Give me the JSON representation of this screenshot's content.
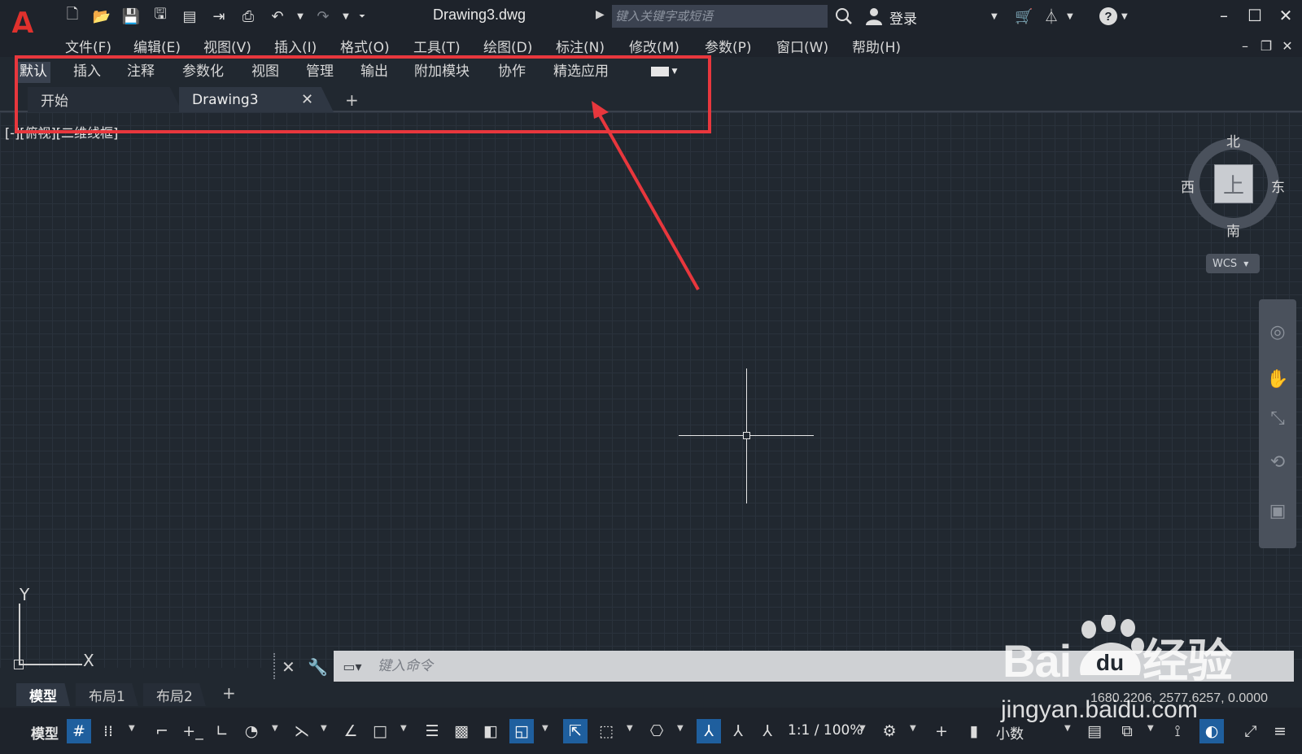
{
  "app": {
    "title": "Drawing3.dwg",
    "logo_letter": "A"
  },
  "title_bar": {
    "search_placeholder": "键入关键字或短语",
    "login_label": "登录",
    "icons": [
      "new-icon",
      "open-icon",
      "save-icon",
      "save-as-icon",
      "plot-preview-icon",
      "export-icon",
      "print-icon",
      "undo-icon",
      "redo-icon",
      "customize-icon",
      "search-icon",
      "user-icon",
      "cart-icon",
      "autodesk-icon",
      "help-icon"
    ]
  },
  "menu": {
    "items": [
      "文件(F)",
      "编辑(E)",
      "视图(V)",
      "插入(I)",
      "格式(O)",
      "工具(T)",
      "绘图(D)",
      "标注(N)",
      "修改(M)",
      "参数(P)",
      "窗口(W)",
      "帮助(H)"
    ]
  },
  "ribbon": {
    "tabs": [
      "默认",
      "插入",
      "注释",
      "参数化",
      "视图",
      "管理",
      "输出",
      "附加模块",
      "协作",
      "精选应用"
    ],
    "active_tab": "默认"
  },
  "file_tabs": {
    "tabs": [
      "开始",
      "Drawing3"
    ],
    "active": "Drawing3",
    "add_label": "+"
  },
  "viewport": {
    "label": "[-][俯视][二维线框]"
  },
  "viewcube": {
    "north": "北",
    "south": "南",
    "east": "东",
    "west": "西",
    "face": "上",
    "wcs_label": "WCS"
  },
  "ucs": {
    "x_label": "X",
    "y_label": "Y"
  },
  "command_line": {
    "placeholder": "键入命令"
  },
  "layout_tabs": {
    "tabs": [
      "模型",
      "布局1",
      "布局2"
    ],
    "active": "模型",
    "add_label": "+"
  },
  "status_bar": {
    "coordinates": "1680.2206, 2577.6257, 0.0000",
    "model_label": "模型",
    "scale_label": "1:1 / 100%",
    "units_label": "小数"
  },
  "watermark": {
    "brand_left": "Bai",
    "brand_right": "经验",
    "brand_paw": "du",
    "url": "jingyan.baidu.com"
  },
  "annotation": {
    "color": "#e8373d"
  }
}
